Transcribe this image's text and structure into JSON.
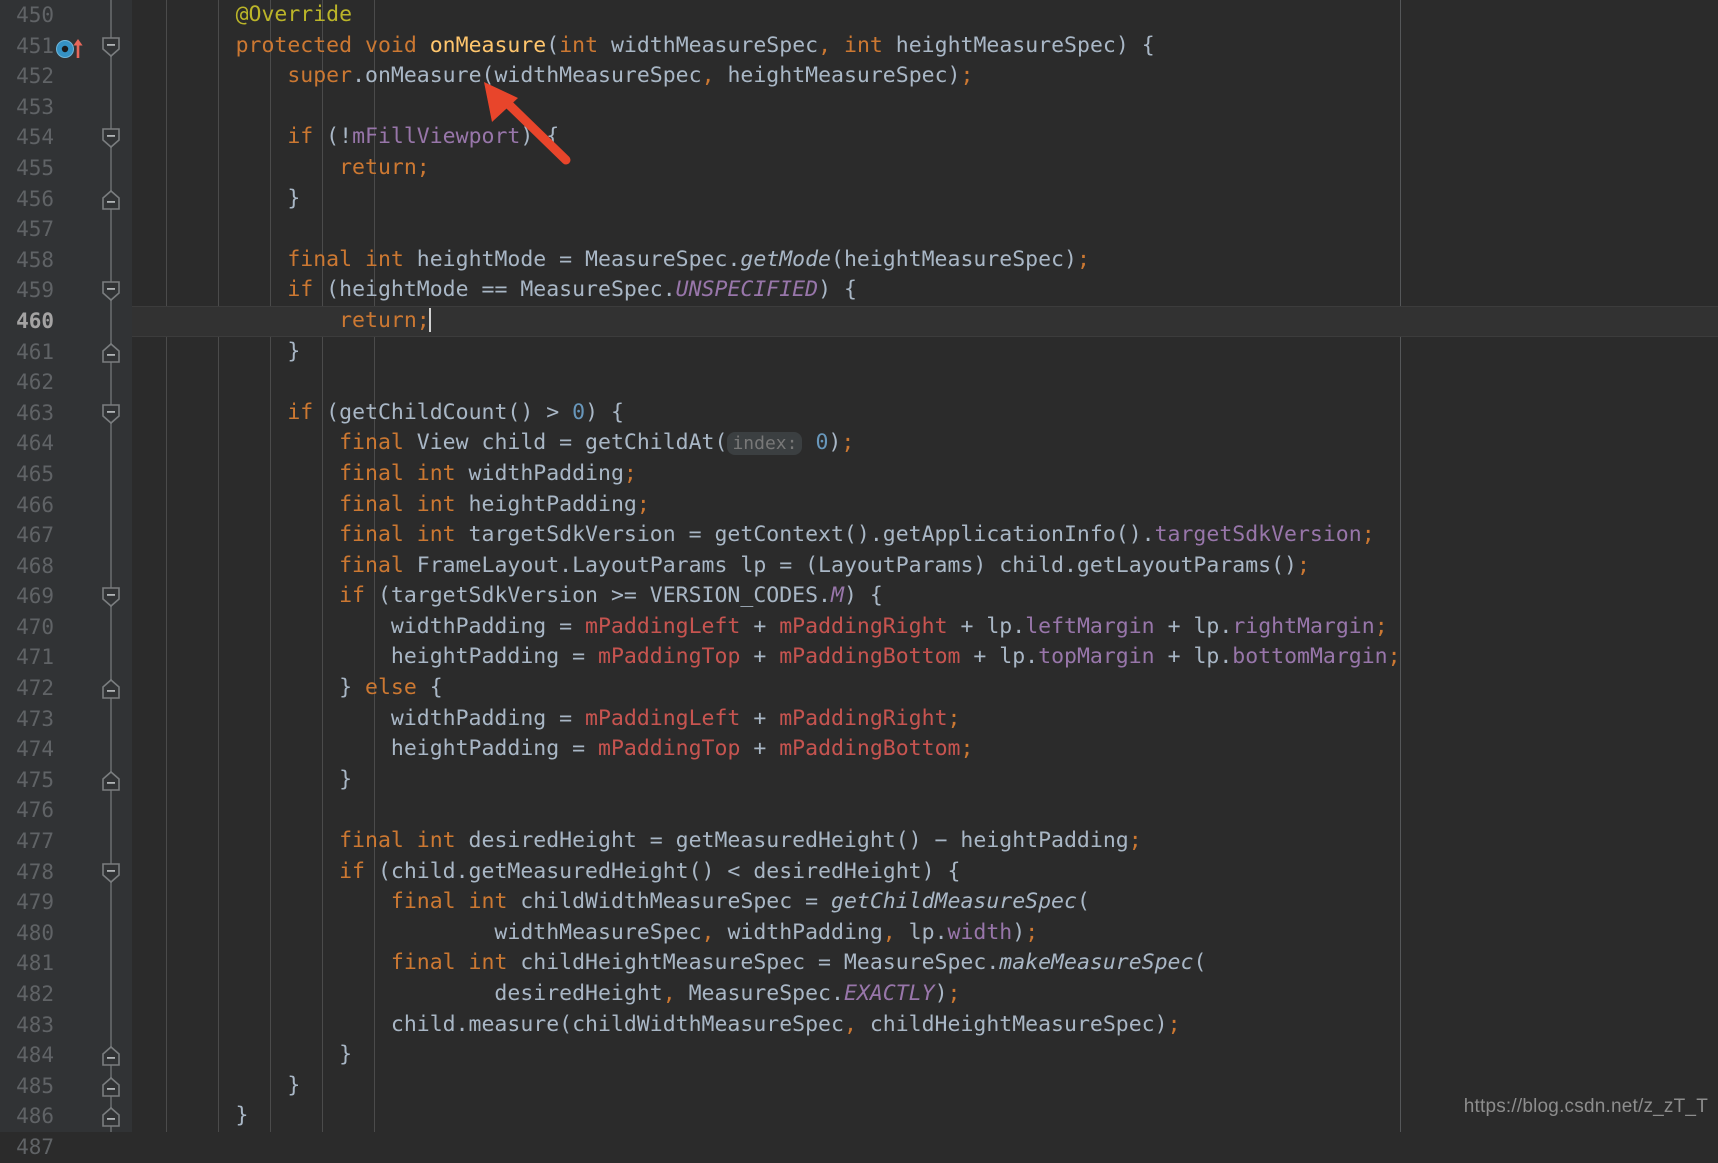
{
  "editor": {
    "theme_name": "darcula",
    "background": "#2b2b2b",
    "gutter_background": "#313335",
    "caret_line_background": "#323232",
    "first_line_number": 450,
    "current_line_number": 460,
    "cursor_line": 460
  },
  "gutter": {
    "line_numbers": [
      "450",
      "451",
      "452",
      "453",
      "454",
      "455",
      "456",
      "457",
      "458",
      "459",
      "460",
      "461",
      "462",
      "463",
      "464",
      "465",
      "466",
      "467",
      "468",
      "469",
      "470",
      "471",
      "472",
      "473",
      "474",
      "475",
      "476",
      "477",
      "478",
      "479",
      "480",
      "481",
      "482",
      "483",
      "484",
      "485",
      "486",
      "487"
    ],
    "override_marker_line": "451",
    "override_marker_icon": "overriding-method-icon",
    "fold_markers": [
      {
        "line": "451",
        "type": "fold-start"
      },
      {
        "line": "454",
        "type": "fold-start"
      },
      {
        "line": "456",
        "type": "fold-end"
      },
      {
        "line": "459",
        "type": "fold-start"
      },
      {
        "line": "461",
        "type": "fold-end"
      },
      {
        "line": "463",
        "type": "fold-start"
      },
      {
        "line": "469",
        "type": "fold-start"
      },
      {
        "line": "472",
        "type": "fold-end"
      },
      {
        "line": "475",
        "type": "fold-end"
      },
      {
        "line": "478",
        "type": "fold-start"
      },
      {
        "line": "484",
        "type": "fold-end"
      },
      {
        "line": "485",
        "type": "fold-end"
      },
      {
        "line": "486",
        "type": "fold-end"
      }
    ]
  },
  "colors": {
    "keyword": "#cc7832",
    "text": "#a9b7c6",
    "annotation": "#bbb529",
    "method_declaration": "#ffc66d",
    "number": "#6897bb",
    "instance_field": "#9876aa",
    "inherited_field": "#c75450",
    "static_final_field": "#9876aa",
    "inlay_hint_text": "#787878",
    "inlay_hint_background": "#3b3f41",
    "line_number": "#606366",
    "current_line_number": "#a4a3a3",
    "arrow_annotation": "#e8452b",
    "watermark": "#8d8d8d"
  },
  "inlay_hints": [
    {
      "line": "464",
      "label": "index:"
    }
  ],
  "annotation_arrow": {
    "name": "red-arrow-annotation",
    "color": "#e8452b",
    "points_to": "widthMeasureSpec argument on line 452"
  },
  "watermark": {
    "text": "https://blog.csdn.net/z_zT_T"
  },
  "code_lines": [
    {
      "n": "450",
      "html": "        <span class=\"ann\">@Override</span>"
    },
    {
      "n": "451",
      "html": "        <span class=\"kw\">protected void</span> <span class=\"mth\">onMeasure</span>(<span class=\"kw\">int</span> widthMeasureSpec<span class=\"kw\">,</span> <span class=\"kw\">int</span> heightMeasureSpec) {"
    },
    {
      "n": "452",
      "html": "            <span class=\"kw\">super</span>.onMeasure(widthMeasureSpec<span class=\"kw\">,</span> heightMeasureSpec)<span class=\"kw\">;</span>"
    },
    {
      "n": "453",
      "html": ""
    },
    {
      "n": "454",
      "html": "            <span class=\"kw\">if</span> (!<span class=\"fld\">mFillViewport</span>) {"
    },
    {
      "n": "455",
      "html": "                <span class=\"kw\">return;</span>"
    },
    {
      "n": "456",
      "html": "            }"
    },
    {
      "n": "457",
      "html": ""
    },
    {
      "n": "458",
      "html": "            <span class=\"kw\">final int</span> heightMode = MeasureSpec.<span class=\"statm\">getMode</span>(heightMeasureSpec)<span class=\"kw\">;</span>"
    },
    {
      "n": "459",
      "html": "            <span class=\"kw\">if</span> (heightMode == MeasureSpec.<span class=\"stat\">UNSPECIFIED</span>) {"
    },
    {
      "n": "460",
      "html": "                <span class=\"kw\">return;</span><span class=\"caret\"></span>"
    },
    {
      "n": "461",
      "html": "            }"
    },
    {
      "n": "462",
      "html": ""
    },
    {
      "n": "463",
      "html": "            <span class=\"kw\">if</span> (getChildCount() &gt; <span class=\"num\">0</span>) {"
    },
    {
      "n": "464",
      "html": "                <span class=\"kw\">final</span> View child = getChildAt(<span class=\"hint\">index:</span> <span class=\"num\">0</span>)<span class=\"kw\">;</span>"
    },
    {
      "n": "465",
      "html": "                <span class=\"kw\">final int</span> widthPadding<span class=\"kw\">;</span>"
    },
    {
      "n": "466",
      "html": "                <span class=\"kw\">final int</span> heightPadding<span class=\"kw\">;</span>"
    },
    {
      "n": "467",
      "html": "                <span class=\"kw\">final int</span> targetSdkVersion = getContext().getApplicationInfo().<span class=\"fld\">targetSdkVersion</span><span class=\"kw\">;</span>"
    },
    {
      "n": "468",
      "html": "                <span class=\"kw\">final</span> FrameLayout.LayoutParams lp = (LayoutParams) child.getLayoutParams()<span class=\"kw\">;</span>"
    },
    {
      "n": "469",
      "html": "                <span class=\"kw\">if</span> (targetSdkVersion &gt;= VERSION_CODES.<span class=\"stat\">M</span>) {"
    },
    {
      "n": "470",
      "html": "                    widthPadding = <span class=\"redfld\">mPaddingLeft</span> + <span class=\"redfld\">mPaddingRight</span> + lp.<span class=\"fld\">leftMargin</span> + lp.<span class=\"fld\">rightMargin</span><span class=\"kw\">;</span>"
    },
    {
      "n": "471",
      "html": "                    heightPadding = <span class=\"redfld\">mPaddingTop</span> + <span class=\"redfld\">mPaddingBottom</span> + lp.<span class=\"fld\">topMargin</span> + lp.<span class=\"fld\">bottomMargin</span><span class=\"kw\">;</span>"
    },
    {
      "n": "472",
      "html": "                } <span class=\"kw\">else</span> {"
    },
    {
      "n": "473",
      "html": "                    widthPadding = <span class=\"redfld\">mPaddingLeft</span> + <span class=\"redfld\">mPaddingRight</span><span class=\"kw\">;</span>"
    },
    {
      "n": "474",
      "html": "                    heightPadding = <span class=\"redfld\">mPaddingTop</span> + <span class=\"redfld\">mPaddingBottom</span><span class=\"kw\">;</span>"
    },
    {
      "n": "475",
      "html": "                }"
    },
    {
      "n": "476",
      "html": ""
    },
    {
      "n": "477",
      "html": "                <span class=\"kw\">final int</span> desiredHeight = getMeasuredHeight() &minus; heightPadding<span class=\"kw\">;</span>"
    },
    {
      "n": "478",
      "html": "                <span class=\"kw\">if</span> (child.getMeasuredHeight() &lt; desiredHeight) {"
    },
    {
      "n": "479",
      "html": "                    <span class=\"kw\">final int</span> childWidthMeasureSpec = <span class=\"statm\">getChildMeasureSpec</span>("
    },
    {
      "n": "480",
      "html": "                            widthMeasureSpec<span class=\"kw\">,</span> widthPadding<span class=\"kw\">,</span> lp.<span class=\"fld\">width</span>)<span class=\"kw\">;</span>"
    },
    {
      "n": "481",
      "html": "                    <span class=\"kw\">final int</span> childHeightMeasureSpec = MeasureSpec.<span class=\"statm\">makeMeasureSpec</span>("
    },
    {
      "n": "482",
      "html": "                            desiredHeight<span class=\"kw\">,</span> MeasureSpec.<span class=\"stat\">EXACTLY</span>)<span class=\"kw\">;</span>"
    },
    {
      "n": "483",
      "html": "                    child.measure(childWidthMeasureSpec<span class=\"kw\">,</span> childHeightMeasureSpec)<span class=\"kw\">;</span>"
    },
    {
      "n": "484",
      "html": "                }"
    },
    {
      "n": "485",
      "html": "            }"
    },
    {
      "n": "486",
      "html": "        }"
    },
    {
      "n": "487",
      "html": ""
    }
  ],
  "code_plain_lines": [
    "    @Override",
    "    protected void onMeasure(int widthMeasureSpec, int heightMeasureSpec) {",
    "        super.onMeasure(widthMeasureSpec, heightMeasureSpec);",
    "",
    "        if (!mFillViewport) {",
    "            return;",
    "        }",
    "",
    "        final int heightMode = MeasureSpec.getMode(heightMeasureSpec);",
    "        if (heightMode == MeasureSpec.UNSPECIFIED) {",
    "            return;",
    "        }",
    "",
    "        if (getChildCount() > 0) {",
    "            final View child = getChildAt( index: 0);",
    "            final int widthPadding;",
    "            final int heightPadding;",
    "            final int targetSdkVersion = getContext().getApplicationInfo().targetSdkVersion;",
    "            final FrameLayout.LayoutParams lp = (LayoutParams) child.getLayoutParams();",
    "            if (targetSdkVersion >= VERSION_CODES.M) {",
    "                widthPadding = mPaddingLeft + mPaddingRight + lp.leftMargin + lp.rightMargin;",
    "                heightPadding = mPaddingTop + mPaddingBottom + lp.topMargin + lp.bottomMargin;",
    "            } else {",
    "                widthPadding = mPaddingLeft + mPaddingRight;",
    "                heightPadding = mPaddingTop + mPaddingBottom;",
    "            }",
    "",
    "            final int desiredHeight = getMeasuredHeight() - heightPadding;",
    "            if (child.getMeasuredHeight() < desiredHeight) {",
    "                final int childWidthMeasureSpec = getChildMeasureSpec(",
    "                        widthMeasureSpec, widthPadding, lp.width);",
    "                final int childHeightMeasureSpec = MeasureSpec.makeMeasureSpec(",
    "                        desiredHeight, MeasureSpec.EXACTLY);",
    "                child.measure(childWidthMeasureSpec, childHeightMeasureSpec);",
    "            }",
    "        }",
    "    }",
    ""
  ]
}
